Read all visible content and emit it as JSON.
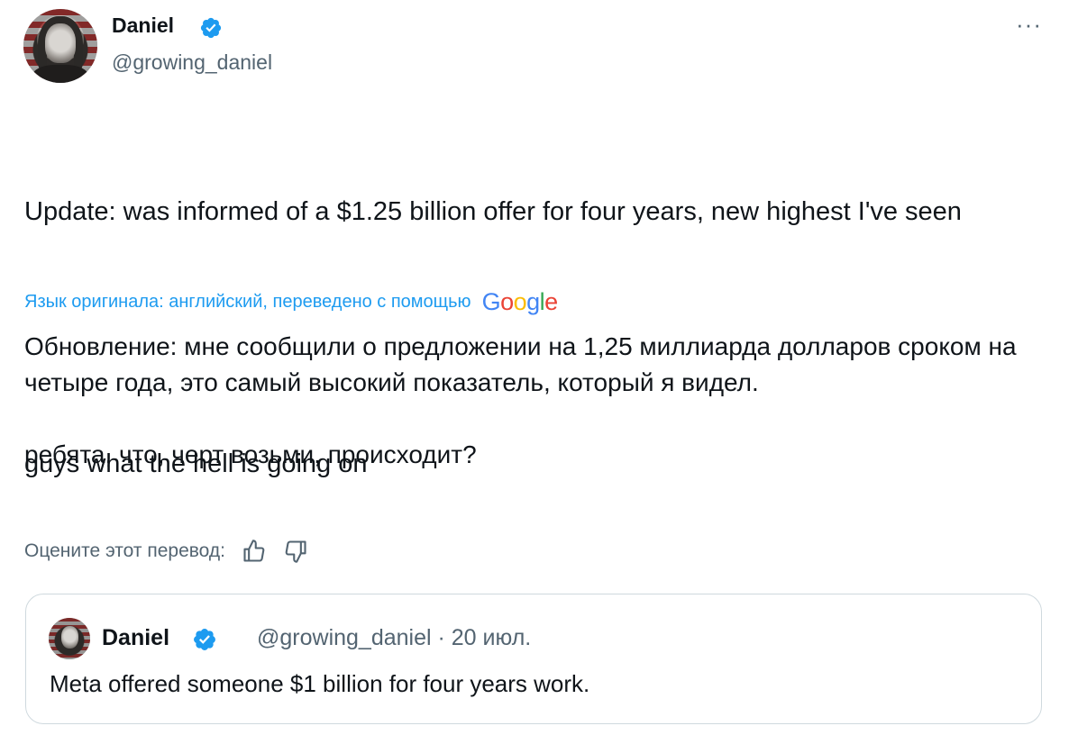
{
  "author": {
    "name": "Daniel",
    "handle": "@growing_daniel",
    "avatar_icon": "profile-photo-with-us-flag-border"
  },
  "menu": {
    "more_label": "···"
  },
  "tweet": {
    "original_paragraphs": [
      "Update: was informed of a $1.25 billion offer for four years, new highest I've seen",
      "guys what the hell is going on"
    ],
    "translation_note": "Язык оригинала: английский, переведено с помощью",
    "translation_provider": "Google",
    "translated_paragraphs": [
      "Обновление: мне сообщили о предложении на 1,25 миллиарда долларов сроком на четыре года, это самый высокий показатель, который я видел.",
      "ребята, что, черт возьми, происходит?"
    ],
    "rate_label": "Оцените этот перевод:"
  },
  "quote": {
    "name": "Daniel",
    "handle_date": "@growing_daniel · 20 июл.",
    "text": "Meta offered someone $1 billion for four years work."
  },
  "colors": {
    "link": "#1d9bf0",
    "verified": "#1d9bf0",
    "secondary": "#536471",
    "text": "#0f1419",
    "border": "#cfd9de"
  }
}
